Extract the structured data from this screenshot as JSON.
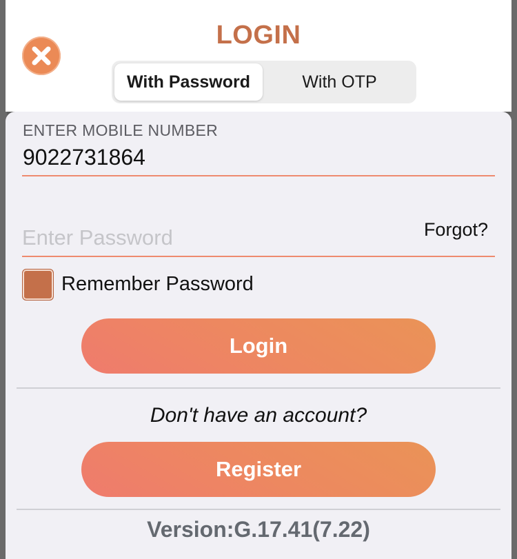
{
  "header": {
    "title": "LOGIN",
    "close_icon": "close-x-icon",
    "tabs": [
      {
        "label": "With Password",
        "selected": true
      },
      {
        "label": "With OTP",
        "selected": false
      }
    ]
  },
  "form": {
    "mobile_label": "ENTER MOBILE NUMBER",
    "mobile_value": "9022731864",
    "password_placeholder": "Enter Password",
    "password_value": "",
    "forgot_label": "Forgot?",
    "remember_label": "Remember Password",
    "remember_checked": true,
    "login_label": "Login"
  },
  "register": {
    "prompt": "Don't have an account?",
    "button_label": "Register"
  },
  "footer": {
    "version": "Version:G.17.41(7.22)"
  },
  "colors": {
    "accent": "#c4704a",
    "button_gradient_start": "#ef7b6d",
    "button_gradient_end": "#ea9357",
    "close_button": "#eb8a56",
    "underline": "#ee8a6e"
  }
}
